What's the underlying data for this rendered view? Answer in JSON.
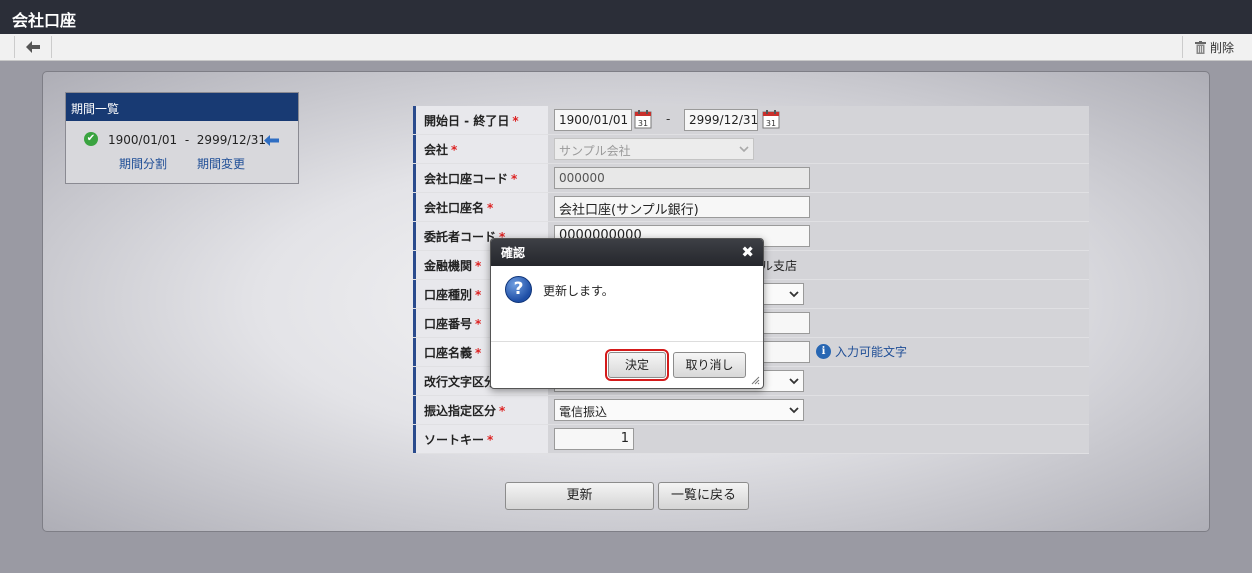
{
  "window": {
    "title": "会社口座"
  },
  "toolbar": {
    "delete_label": "削除"
  },
  "period_list": {
    "header": "期間一覧",
    "entry": {
      "start": "1900/01/01",
      "sep": "-",
      "end": "2999/12/31"
    },
    "split_label": "期間分割",
    "change_label": "期間変更"
  },
  "form": {
    "period": {
      "label": "開始日 - 終了日",
      "start": "1900/01/01",
      "sep": "-",
      "end": "2999/12/31"
    },
    "company": {
      "label": "会社",
      "value": "サンプル会社"
    },
    "account_code": {
      "label": "会社口座コード",
      "value": "000000"
    },
    "account_name": {
      "label": "会社口座名",
      "value": "会社口座(サンプル銀行)"
    },
    "consignor_code": {
      "label": "委託者コード",
      "value": "0000000000"
    },
    "bank": {
      "label": "金融機関",
      "value_fragment": "ル支店"
    },
    "account_type": {
      "label": "口座種別"
    },
    "account_number": {
      "label": "口座番号"
    },
    "account_holder": {
      "label": "口座名義",
      "hint": "入力可能文字"
    },
    "newline_type": {
      "label": "改行文字区分"
    },
    "transfer_type": {
      "label": "振込指定区分",
      "value": "電信振込"
    },
    "sort_key": {
      "label": "ソートキー",
      "value": "1"
    },
    "required_mark": "*"
  },
  "actions": {
    "update_label": "更新",
    "back_label": "一覧に戻る"
  },
  "dialog": {
    "title": "確認",
    "close_glyph": "✖",
    "message": "更新します。",
    "ok_label": "決定",
    "cancel_label": "取り消し"
  }
}
